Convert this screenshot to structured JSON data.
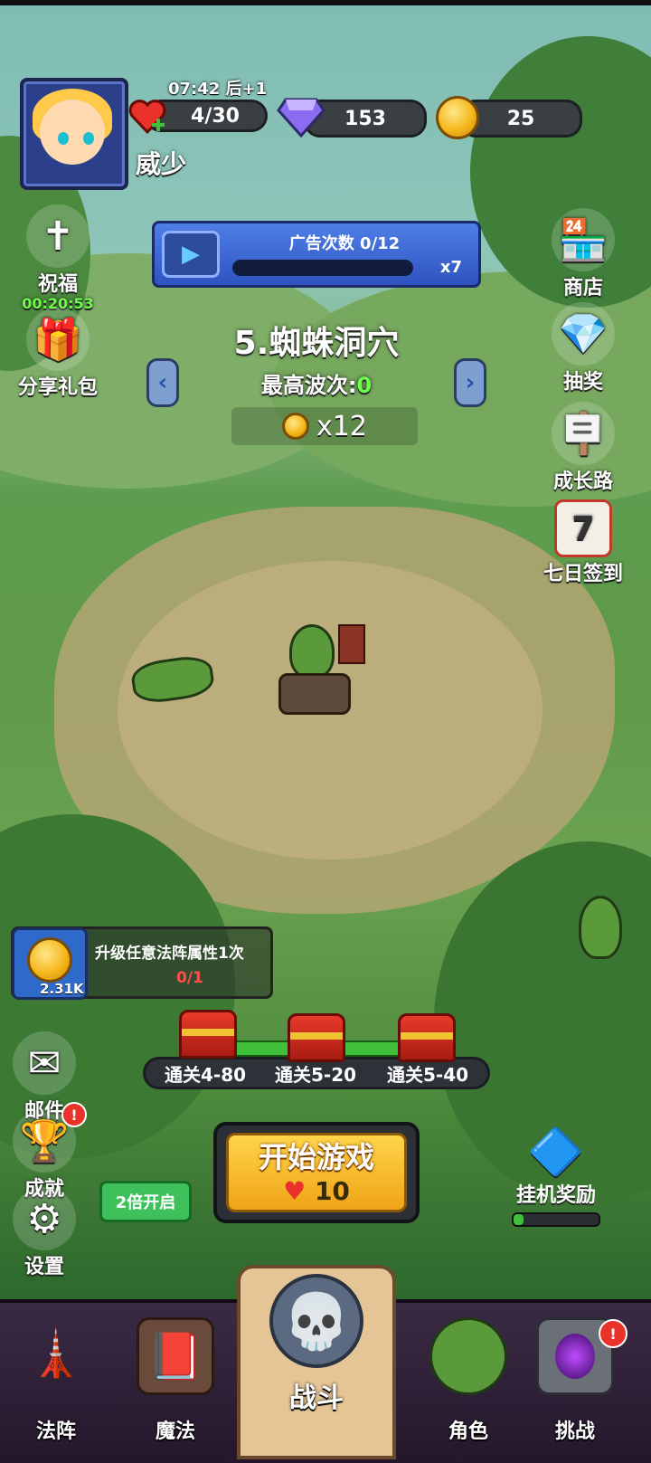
{
  "header": {
    "time": "07:42 后+1",
    "hearts": "4/30",
    "diamonds": "153",
    "coins": "25",
    "player_name": "威少"
  },
  "left_menu": {
    "blessing_label": "祝福",
    "blessing_timer": "00:20:53",
    "share_label": "分享礼包",
    "mail_label": "邮件",
    "achievement_label": "成就",
    "settings_label": "设置"
  },
  "right_menu": {
    "shop_label": "商店",
    "lottery_label": "抽奖",
    "growth_label": "成长路",
    "signin_label": "七日签到",
    "signin_day": "7"
  },
  "ad": {
    "label": "广告次数 0/12",
    "multiplier": "x7",
    "progress": 0
  },
  "stage": {
    "title": "5.蜘蛛洞穴",
    "wave_label": "最高波次:",
    "wave_value": "0",
    "reward": "x12"
  },
  "task": {
    "text": "升级任意法阵属性1次",
    "progress": "0/1",
    "reward_amount": "2.31K"
  },
  "chests": [
    {
      "label": "通关4-80"
    },
    {
      "label": "通关5-20"
    },
    {
      "label": "通关5-40"
    }
  ],
  "start": {
    "title": "开始游戏",
    "cost": "10"
  },
  "double_label": "2倍开启",
  "afk": {
    "label": "挂机奖励",
    "progress": 0.12
  },
  "nav": {
    "formation": "法阵",
    "magic": "魔法",
    "battle": "战斗",
    "character": "角色",
    "challenge": "挑战"
  },
  "colors": {
    "green_accent": "#3fbf3a",
    "gold": "#f5b81c",
    "badge_red": "#e8322a"
  }
}
